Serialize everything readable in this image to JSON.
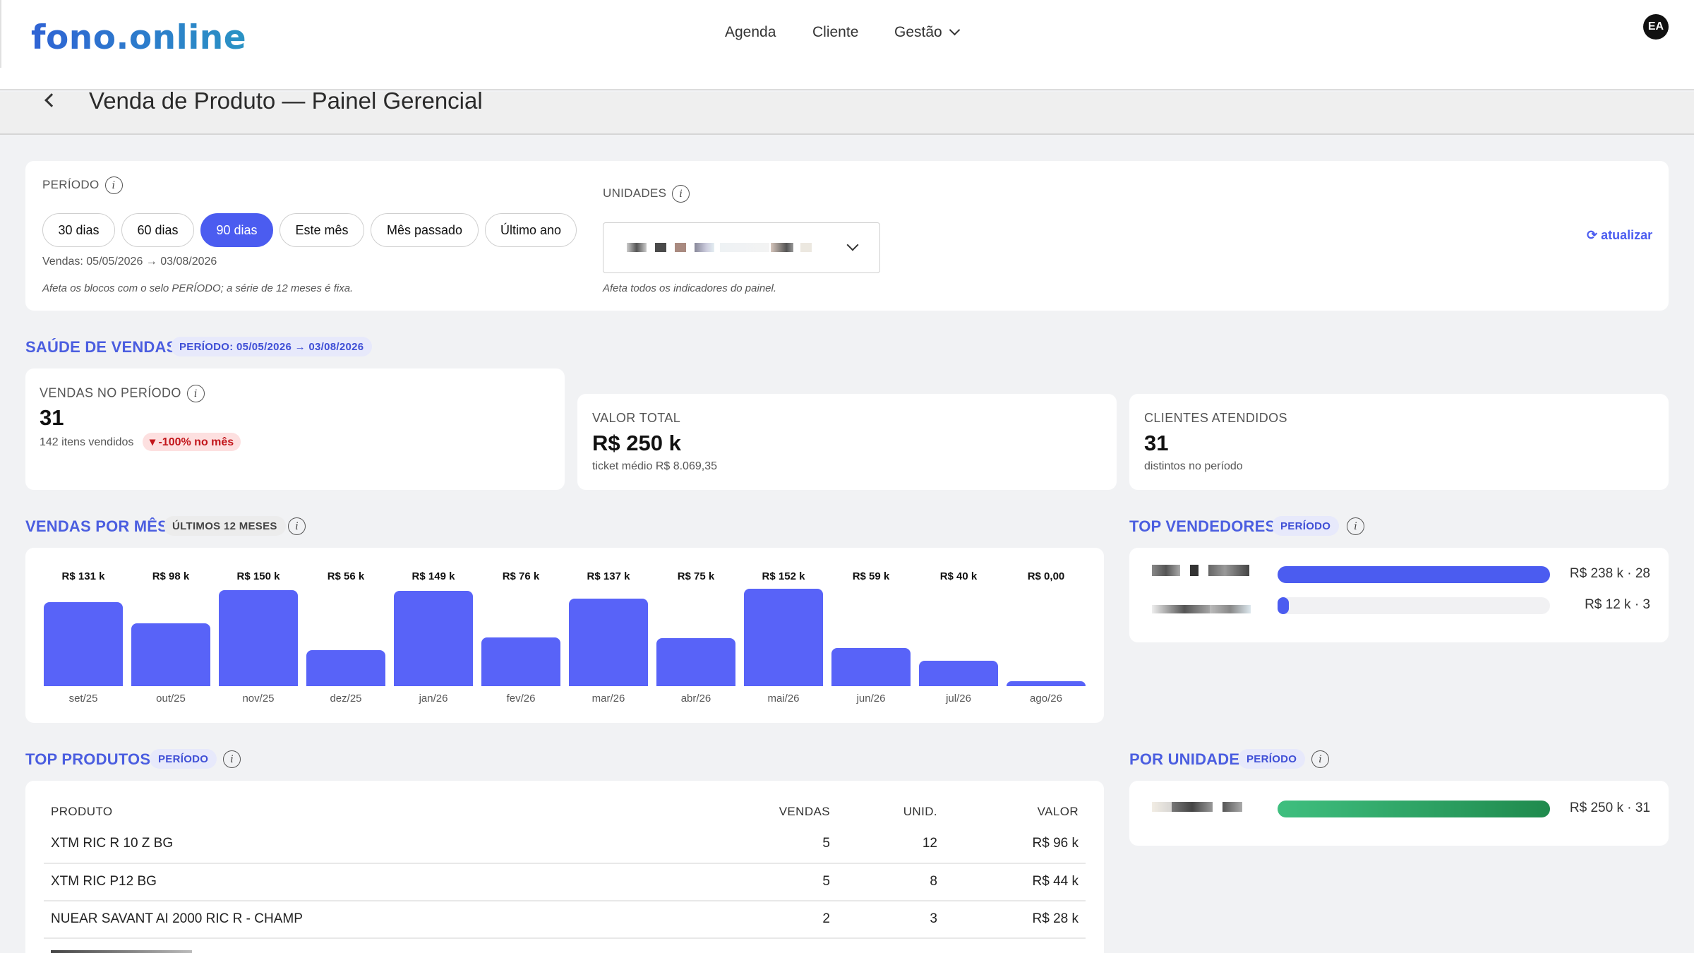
{
  "header": {
    "logo": "fono.online",
    "nav": [
      {
        "label": "Agenda"
      },
      {
        "label": "Cliente"
      },
      {
        "label": "Gestão"
      }
    ],
    "avatar": "EA"
  },
  "page": {
    "title": "Venda de Produto — Painel Gerencial"
  },
  "filters": {
    "period_label": "PERÍODO",
    "period_options": [
      "30 dias",
      "60 dias",
      "90 dias",
      "Este mês",
      "Mês passado",
      "Último ano"
    ],
    "period_selected": "90 dias",
    "sales_range": "Vendas: 05/05/2026 → 03/08/2026",
    "period_note": "Afeta os blocos com o selo PERÍODO; a série de 12 meses é fixa.",
    "units_label": "UNIDADES",
    "units_note": "Afeta todos os indicadores do painel.",
    "refresh_label": "⟳ atualizar"
  },
  "health": {
    "title": "SAÚDE DE VENDAS",
    "tag": "PERÍODO: 05/05/2026 → 03/08/2026",
    "kpis": [
      {
        "label": "VENDAS NO PERÍODO",
        "value": "31",
        "sub": "142 itens vendidos",
        "badge": "▾ -100% no mês"
      },
      {
        "label": "VALOR TOTAL",
        "value": "R$ 250 k",
        "sub": "ticket médio R$ 8.069,35"
      },
      {
        "label": "CLIENTES ATENDIDOS",
        "value": "31",
        "sub": "distintos no período"
      }
    ]
  },
  "monthly": {
    "title": "VENDAS POR MÊS",
    "tag": "ÚLTIMOS 12 MESES"
  },
  "chart_data": {
    "type": "bar",
    "categories": [
      "set/25",
      "out/25",
      "nov/25",
      "dez/25",
      "jan/26",
      "fev/26",
      "mar/26",
      "abr/26",
      "mai/26",
      "jun/26",
      "jul/26",
      "ago/26"
    ],
    "values": [
      131,
      98,
      150,
      56,
      149,
      76,
      137,
      75,
      152,
      59,
      40,
      0
    ],
    "data_labels": [
      "R$ 131 k",
      "R$ 98 k",
      "R$ 150 k",
      "R$ 56 k",
      "R$ 149 k",
      "R$ 76 k",
      "R$ 137 k",
      "R$ 75 k",
      "R$ 152 k",
      "R$ 59 k",
      "R$ 40 k",
      "R$ 0,00"
    ],
    "color": "#5863f8",
    "title": "",
    "xlabel": "",
    "ylabel": ""
  },
  "sellers": {
    "title": "TOP VENDEDORES",
    "tag": "PERÍODO",
    "rows": [
      {
        "value_label": "R$ 238 k · 28",
        "share": 1.0
      },
      {
        "value_label": "R$ 12 k · 3",
        "share": 0.04
      }
    ],
    "color": "#4b5cf0"
  },
  "products": {
    "title": "TOP PRODUTOS",
    "tag": "PERÍODO",
    "columns": [
      "PRODUTO",
      "VENDAS",
      "UNID.",
      "VALOR"
    ],
    "rows": [
      {
        "produto": "XTM RIC R 10 Z BG",
        "vendas": "5",
        "unid": "12",
        "valor": "R$ 96 k"
      },
      {
        "produto": "XTM RIC P12 BG",
        "vendas": "5",
        "unid": "8",
        "valor": "R$ 44 k"
      },
      {
        "produto": "NUEAR SAVANT AI 2000 RIC R - CHAMP",
        "vendas": "2",
        "unid": "3",
        "valor": "R$ 28 k"
      }
    ]
  },
  "units": {
    "title": "POR UNIDADE",
    "tag": "PERÍODO",
    "rows": [
      {
        "value_label": "R$ 250 k · 31",
        "share": 1.0
      }
    ],
    "color": "#27a06a"
  }
}
